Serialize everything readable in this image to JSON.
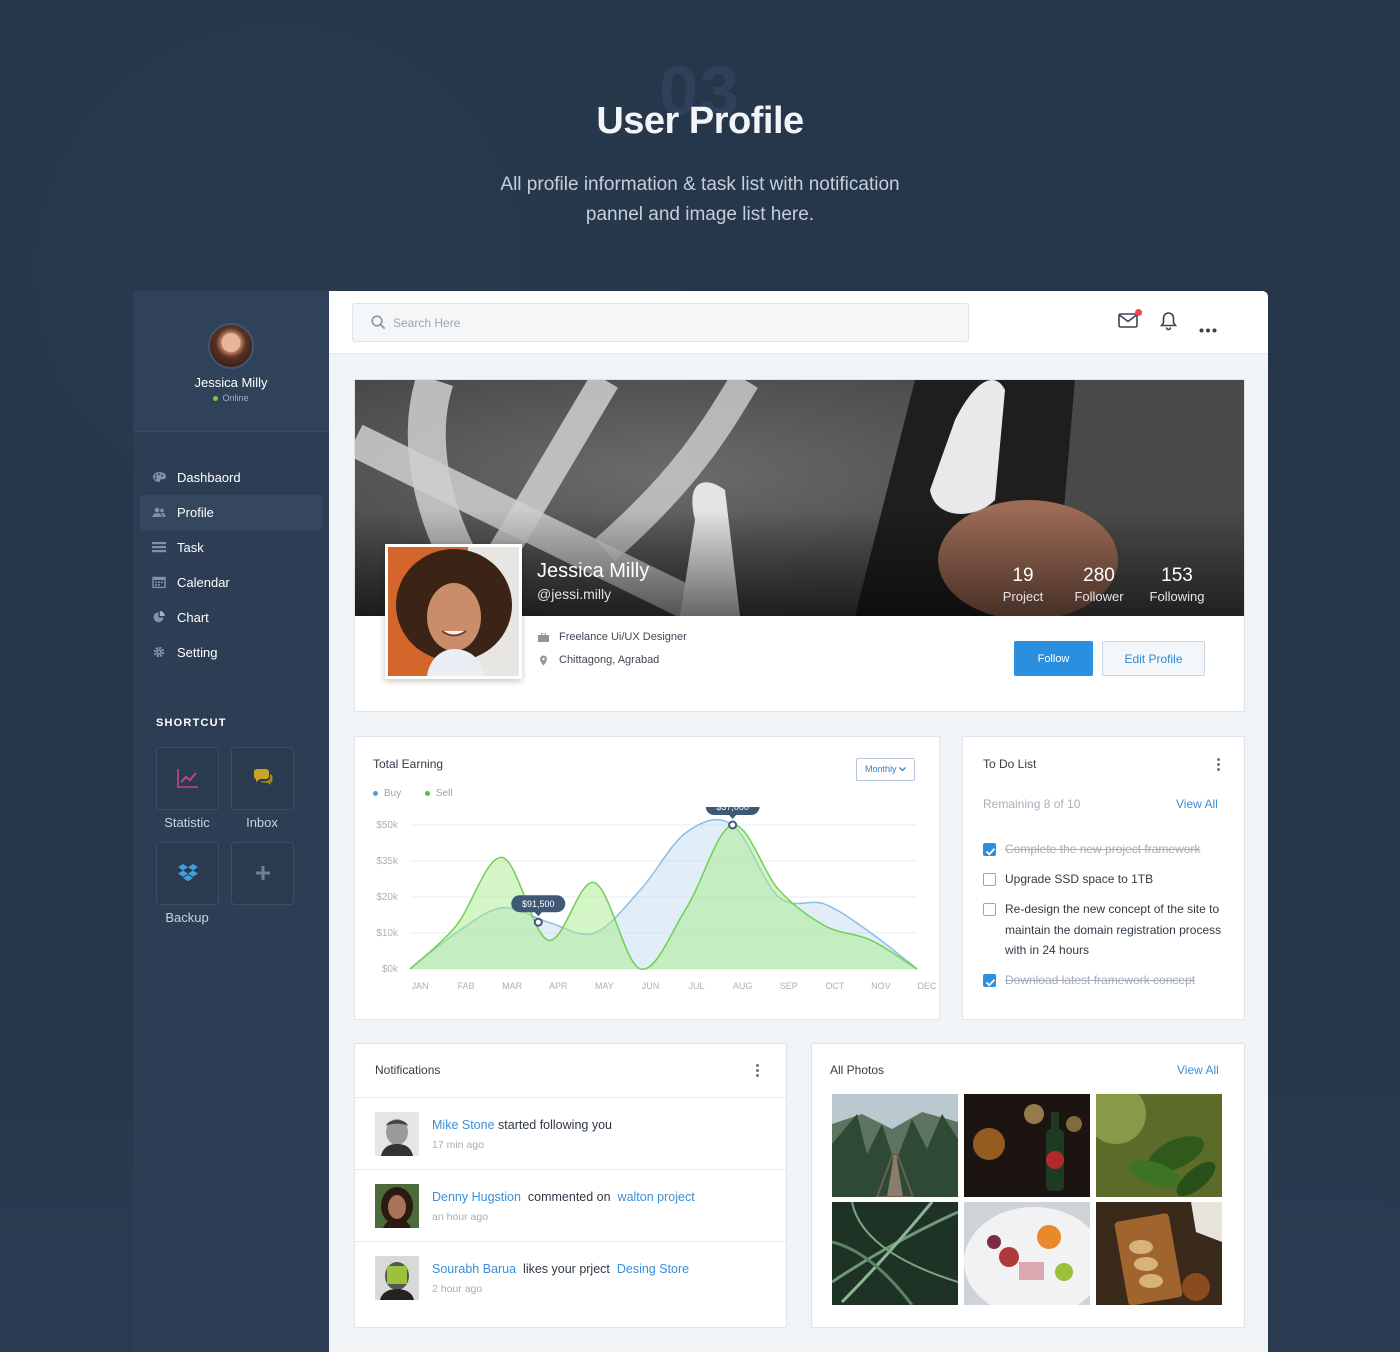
{
  "hero": {
    "number": "03",
    "title": "User Profile",
    "subtitle_line1": "All profile information & task list with notification",
    "subtitle_line2": "pannel and image list here."
  },
  "sidebar": {
    "user_name": "Jessica Milly",
    "status": "Online",
    "nav": [
      {
        "label": "Dashbaord",
        "icon": "palette-icon"
      },
      {
        "label": "Profile",
        "icon": "users-icon",
        "active": true
      },
      {
        "label": "Task",
        "icon": "list-icon"
      },
      {
        "label": "Calendar",
        "icon": "calendar-icon"
      },
      {
        "label": "Chart",
        "icon": "pie-chart-icon"
      },
      {
        "label": "Setting",
        "icon": "gear-icon"
      }
    ],
    "shortcut_title": "SHORTCUT",
    "shortcuts": [
      {
        "label": "Statistic",
        "icon": "line-chart-icon",
        "color": "#c2467a"
      },
      {
        "label": "Inbox",
        "icon": "chat-bubbles-icon",
        "color": "#c9a227"
      },
      {
        "label": "Backup",
        "icon": "dropbox-icon",
        "color": "#3aa0e0"
      },
      {
        "label": "",
        "icon": "plus-icon",
        "color": "#6f8197"
      }
    ]
  },
  "topbar": {
    "search_placeholder": "Search Here",
    "icons": [
      "mail-icon",
      "bell-icon",
      "more-horizontal-icon"
    ]
  },
  "profile": {
    "name": "Jessica Milly",
    "handle": "@jessi.milly",
    "stats": [
      {
        "value": "19",
        "label": "Project"
      },
      {
        "value": "280",
        "label": "Follower"
      },
      {
        "value": "153",
        "label": "Following"
      }
    ],
    "role": "Freelance Ui/UX Designer",
    "location": "Chittagong, Agrabad",
    "follow_label": "Follow",
    "edit_label": "Edit Profile"
  },
  "earning": {
    "title": "Total Earning",
    "period": "Monthly",
    "legend": [
      {
        "name": "Buy",
        "color": "#4a9fe0"
      },
      {
        "name": "Sell",
        "color": "#4cc43a"
      }
    ],
    "y_ticks": [
      "$50k",
      "$35k",
      "$20k",
      "$10k",
      "$0k"
    ],
    "x_ticks": [
      "JAN",
      "FAB",
      "MAR",
      "APR",
      "MAY",
      "JUN",
      "JUL",
      "AUG",
      "SEP",
      "OCT",
      "NOV",
      "DEC"
    ],
    "callout_1": "$91,500",
    "callout_2": "$37,000"
  },
  "chart_data": {
    "type": "area",
    "title": "Total Earning",
    "categories": [
      "JAN",
      "FAB",
      "MAR",
      "APR",
      "MAY",
      "JUN",
      "JUL",
      "AUG",
      "SEP",
      "OCT",
      "NOV",
      "DEC"
    ],
    "y_ticks": [
      "$50k",
      "$35k",
      "$20k",
      "$10k",
      "$0k"
    ],
    "series": [
      {
        "name": "Buy",
        "values": [
          0,
          10,
          17,
          13,
          10,
          22,
          38,
          40,
          20,
          18,
          10,
          0
        ]
      },
      {
        "name": "Sell",
        "values": [
          0,
          12,
          31,
          8,
          24,
          0,
          17,
          40,
          22,
          12,
          8,
          0
        ]
      }
    ],
    "annotations": [
      {
        "label": "$91,500",
        "category": "APR"
      },
      {
        "label": "$37,000",
        "category": "AUG"
      }
    ],
    "grid": true,
    "legend": "top-left"
  },
  "todo": {
    "title": "To Do List",
    "remaining": "Remaining 8 of 10",
    "view_all": "View All",
    "tasks": [
      {
        "text": "Complete the new project framework",
        "done": true
      },
      {
        "text": "Upgrade SSD space to 1TB",
        "done": false
      },
      {
        "text": "Re-design the new concept of the site to maintain the domain registration process with in 24 hours",
        "done": false
      },
      {
        "text": "Download latest framework concept",
        "done": true
      }
    ]
  },
  "notifications": {
    "title": "Notifications",
    "items": [
      {
        "user": "Mike Stone",
        "action": "started following you",
        "target": "",
        "time": "17 min ago"
      },
      {
        "user": "Denny Hugstion",
        "action": "commented on",
        "target": "walton project",
        "time": "an hour ago"
      },
      {
        "user": "Sourabh Barua",
        "action": "likes your prject",
        "target": "Desing Store",
        "time": "2 hour ago"
      }
    ]
  },
  "photos": {
    "title": "All Photos",
    "view_all": "View All"
  }
}
